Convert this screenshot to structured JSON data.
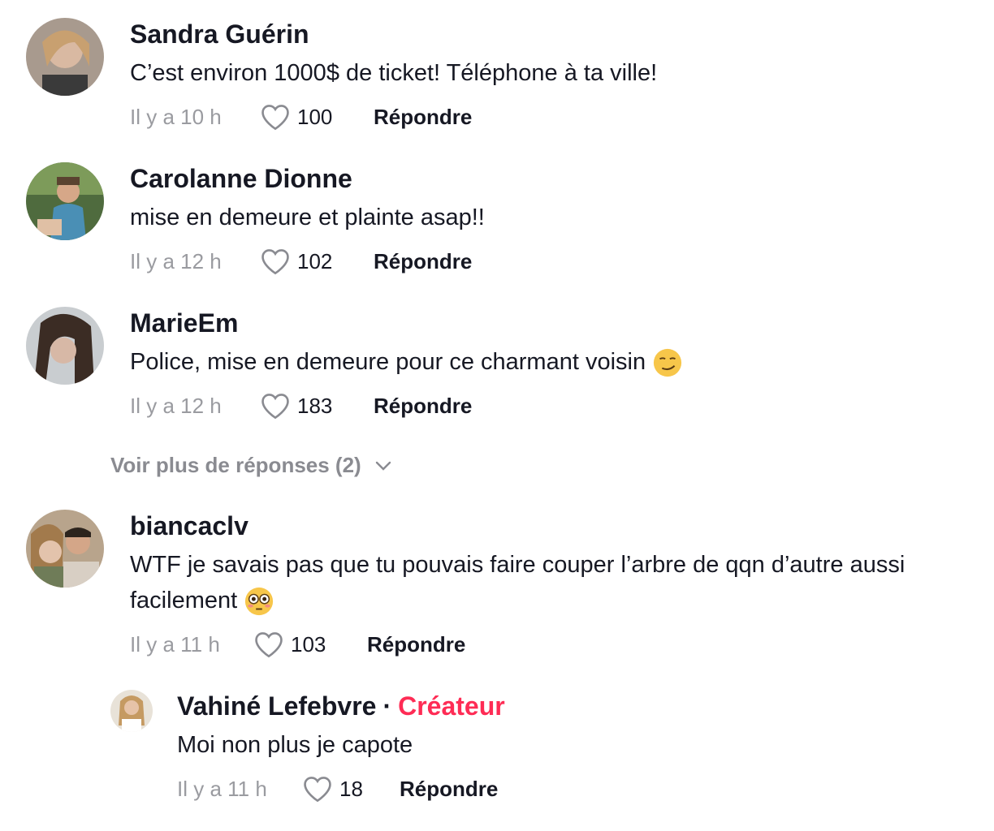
{
  "comments": [
    {
      "username": "Sandra Guérin",
      "text": "C’est environ 1000$ de ticket! Téléphone à ta ville!",
      "time": "Il y a 10 h",
      "likes": "100",
      "reply_label": "Répondre"
    },
    {
      "username": "Carolanne Dionne",
      "text": "mise en demeure et plainte asap!!",
      "time": "Il y a 12 h",
      "likes": "102",
      "reply_label": "Répondre"
    },
    {
      "username": "MarieEm",
      "text": "Police, mise en demeure pour ce charmant voisin",
      "emoji": "smirking-face",
      "time": "Il y a 12 h",
      "likes": "183",
      "reply_label": "Répondre"
    },
    {
      "username": "biancaclv",
      "text": "WTF je savais pas que tu pouvais faire couper l’arbre de qqn d’autre aussi facilement",
      "emoji": "flushed-face",
      "time": "Il y a 11 h",
      "likes": "103",
      "reply_label": "Répondre"
    }
  ],
  "view_more": {
    "label": "Voir plus de réponses (2)"
  },
  "reply": {
    "username": "Vahiné Lefebvre",
    "separator": "·",
    "badge": "Créateur",
    "text": "Moi non plus je capote",
    "time": "Il y a 11 h",
    "likes": "18",
    "reply_label": "Répondre"
  },
  "colors": {
    "creator_badge": "#fe2c55",
    "muted": "#9a9ba0",
    "text": "#161823"
  }
}
